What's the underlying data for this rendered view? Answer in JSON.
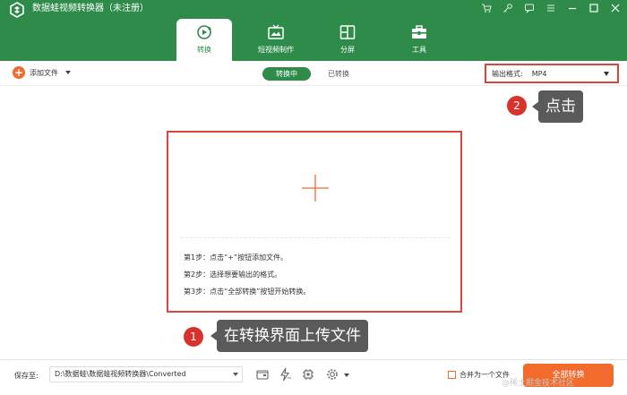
{
  "window": {
    "title": "数据蛙视频转换器（未注册）"
  },
  "tabs": [
    {
      "label": "转换",
      "icon": "convert-icon",
      "active": true
    },
    {
      "label": "短视频制作",
      "icon": "tv-icon",
      "active": false
    },
    {
      "label": "分屏",
      "icon": "split-screen-icon",
      "active": false
    },
    {
      "label": "工具",
      "icon": "toolbox-icon",
      "active": false
    }
  ],
  "toolbar": {
    "add_file": "添加文件",
    "converting": "转换中",
    "converted": "已转换",
    "output_format_label": "输出格式:",
    "output_format_value": "MP4"
  },
  "annotations": {
    "step1_number": "1",
    "step1_text": "在转换界面上传文件",
    "step2_number": "2",
    "step2_text": "点击"
  },
  "drop_area": {
    "steps": [
      "第1步：点击“+”按钮添加文件。",
      "第2步：选择想要输出的格式。",
      "第3步：点击“全部转换”按钮开始转换。"
    ]
  },
  "bottom": {
    "save_to": "保存至:",
    "save_path": "D:\\数据蛙\\数据蛙视频转换器\\Converted",
    "merge_label": "合并为一个文件",
    "convert_all": "全部转换"
  },
  "watermark": "@稀土掘金技术社区",
  "colors": {
    "brand_green": "#2e8b4a",
    "accent_orange": "#f26a2c",
    "annotation_red": "#d9453f"
  }
}
